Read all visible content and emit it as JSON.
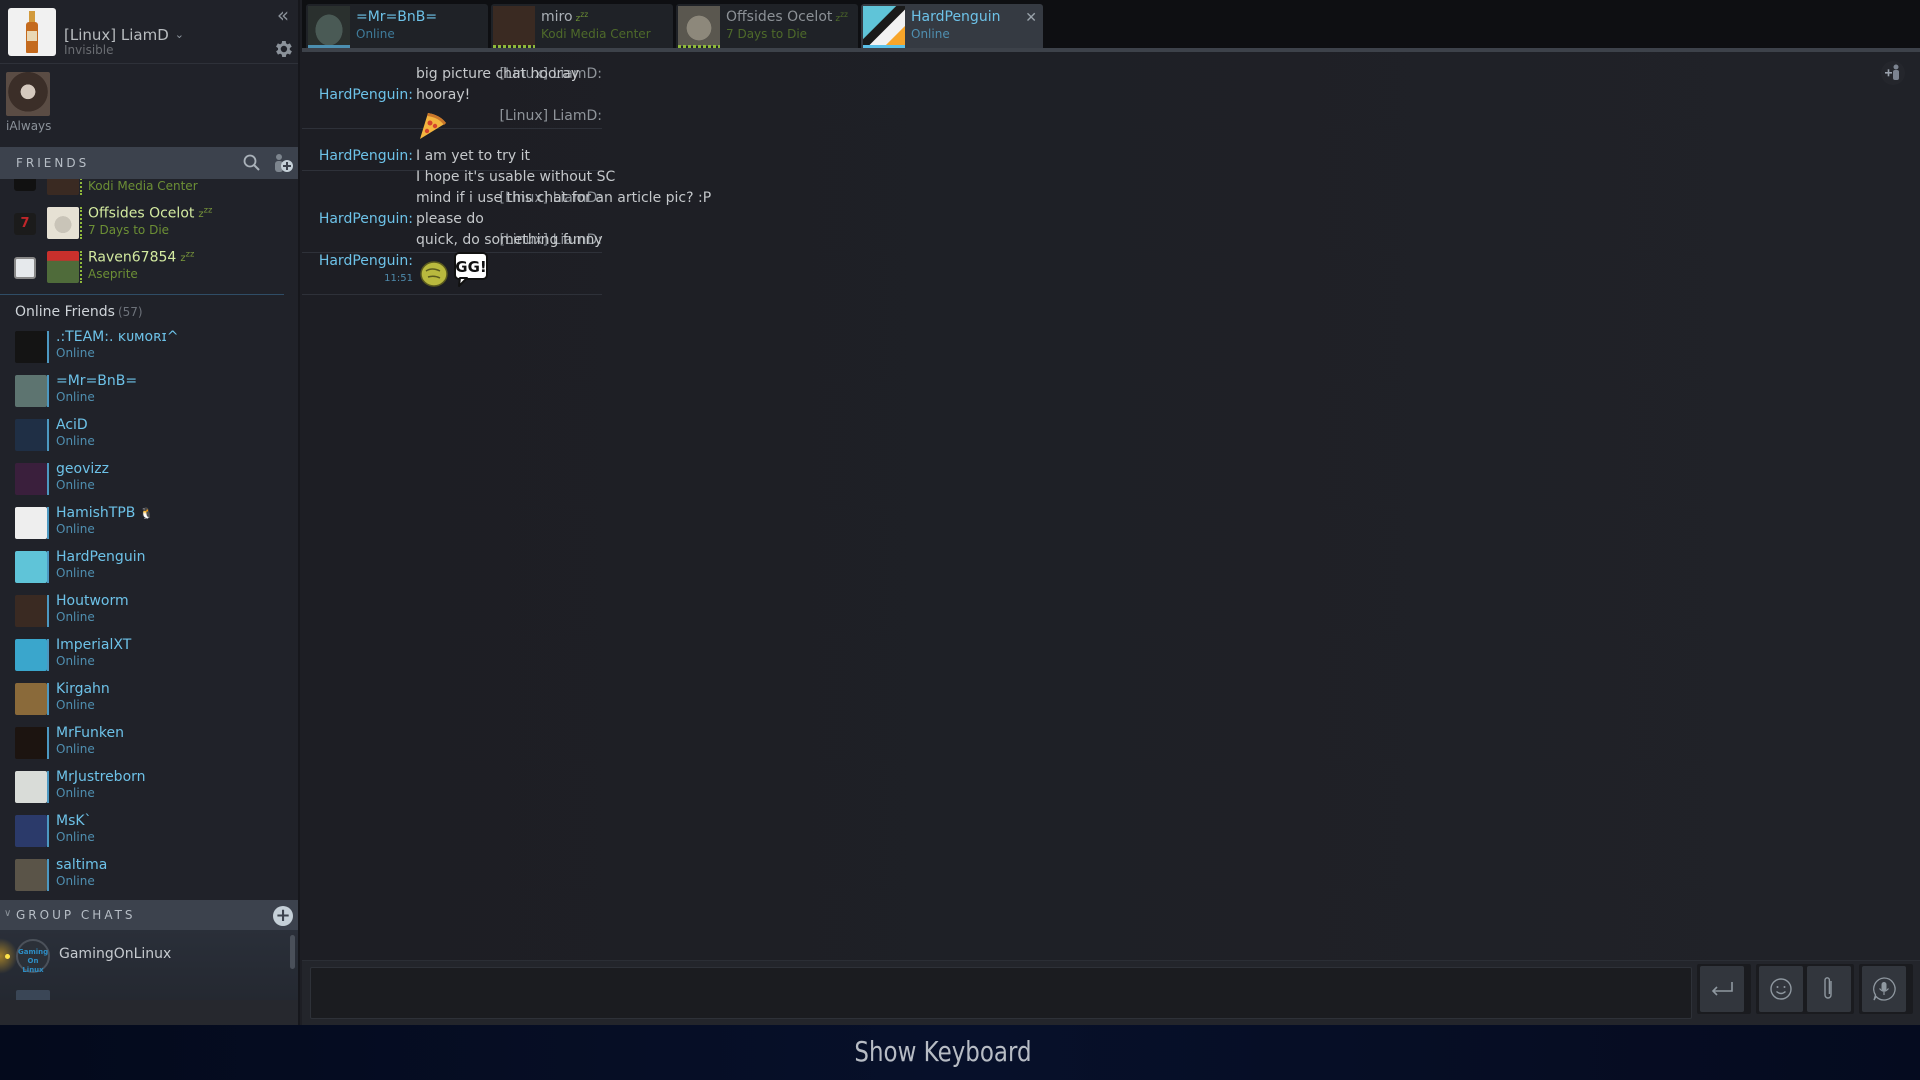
{
  "self": {
    "name": "[Linux] LiamD",
    "status": "Invisible",
    "collapse_icon": "double-chevron-left-icon",
    "settings_icon": "gear-icon"
  },
  "favorites": [
    {
      "name": "iAlways"
    }
  ],
  "friends_header": {
    "title": "FRIENDS",
    "search_icon": "search-icon",
    "add_friend_icon": "add-friend-icon"
  },
  "ingame_friends": [
    {
      "name": "miro",
      "game": "Kodi Media Center",
      "away": true,
      "avatar_color": "#3a2a22",
      "icon_color": "#111111"
    },
    {
      "name": "Offsides Ocelot",
      "game": "7 Days to Die",
      "away": true,
      "avatar_color": "#e6e1d4",
      "icon_color": "#1b1b1b"
    },
    {
      "name": "Raven67854",
      "game": "Aseprite",
      "away": true,
      "avatar_color": "#4f6b3a",
      "icon_color": "#e6e9ec"
    }
  ],
  "online_group": {
    "title": "Online Friends",
    "count": "(57)"
  },
  "online_friends": [
    {
      "name": ".:TEAM:. ᴋᴜᴍᴏʀɪ^",
      "status": "Online",
      "avatar_color": "#141414"
    },
    {
      "name": "=Mr=BnB=",
      "status": "Online",
      "avatar_color": "#5d7470"
    },
    {
      "name": "AciD",
      "status": "Online",
      "avatar_color": "#1f2f45"
    },
    {
      "name": "geovizz",
      "status": "Online",
      "avatar_color": "#3a1f3c"
    },
    {
      "name": "HamishTPB",
      "status": "Online",
      "avatar_color": "#eeeeee",
      "extra": "🐧"
    },
    {
      "name": "HardPenguin",
      "status": "Online",
      "avatar_color": "#5fc4d8"
    },
    {
      "name": "Houtworm",
      "status": "Online",
      "avatar_color": "#3a2a22"
    },
    {
      "name": "ImperialXT",
      "status": "Online",
      "avatar_color": "#3aa6cc"
    },
    {
      "name": "Kirgahn",
      "status": "Online",
      "avatar_color": "#8a6a3a"
    },
    {
      "name": "MrFunken",
      "status": "Online",
      "avatar_color": "#1c1410"
    },
    {
      "name": "MrJustreborn",
      "status": "Online",
      "avatar_color": "#d9dcd8"
    },
    {
      "name": "MsK`",
      "status": "Online",
      "avatar_color": "#2b3a6a"
    },
    {
      "name": "saltima",
      "status": "Online",
      "avatar_color": "#5a5448"
    }
  ],
  "group_chats": {
    "title": "GROUP CHATS",
    "add_icon": "add-group-chat-icon",
    "items": [
      {
        "name": "GamingOnLinux",
        "avatar_text": "Gaming On Linux",
        "unread": true
      }
    ]
  },
  "tabs": [
    {
      "name": "=Mr=BnB=",
      "sub": "Online",
      "state": "online",
      "active": false,
      "avatar_color": "#38443f"
    },
    {
      "name": "miro",
      "sub": "Kodi Media Center",
      "state": "ingame",
      "away": true,
      "active": false,
      "avatar_color": "#3a2a22"
    },
    {
      "name": "Offsides Ocelot",
      "sub": "7 Days to Die",
      "state": "ingame",
      "away": true,
      "active": false,
      "avatar_color": "#6f6c62"
    },
    {
      "name": "HardPenguin",
      "sub": "Online",
      "state": "online",
      "active": true,
      "avatar_color": "#5fc4d8"
    }
  ],
  "chat": {
    "add_user_icon": "add-user-to-chat-icon",
    "messages": [
      {
        "author": "[Linux] LiamD:",
        "self": true,
        "text": "big picture chat hooray"
      },
      {
        "author": "HardPenguin:",
        "self": false,
        "text": "hooray!"
      },
      {
        "author": "[Linux] LiamD:",
        "self": true,
        "emote": "pizza-emoticon"
      },
      {
        "author": "HardPenguin:",
        "self": false,
        "text": "I am yet to try it"
      },
      {
        "author": "",
        "self": false,
        "text": "I hope it's usable without SC"
      },
      {
        "author": "[Linux] LiamD:",
        "self": true,
        "text": "mind if i use this chat for an article pic? :P"
      },
      {
        "author": "HardPenguin:",
        "self": false,
        "text": "please do"
      },
      {
        "author": "[Linux] LiamD:",
        "self": true,
        "text": "quick, do something funny"
      },
      {
        "author": "HardPenguin:",
        "self": false,
        "time": "11:51",
        "emotes": [
          "green-blob-emoticon",
          "gg-emoticon"
        ],
        "gg_text": "GG!"
      }
    ]
  },
  "input": {
    "value": "",
    "placeholder": "",
    "send_icon": "enter-icon",
    "emoji_icon": "smiley-icon",
    "attach_icon": "paperclip-icon",
    "voice_icon": "microphone-icon"
  },
  "bottom": {
    "show_keyboard": "Show Keyboard"
  }
}
